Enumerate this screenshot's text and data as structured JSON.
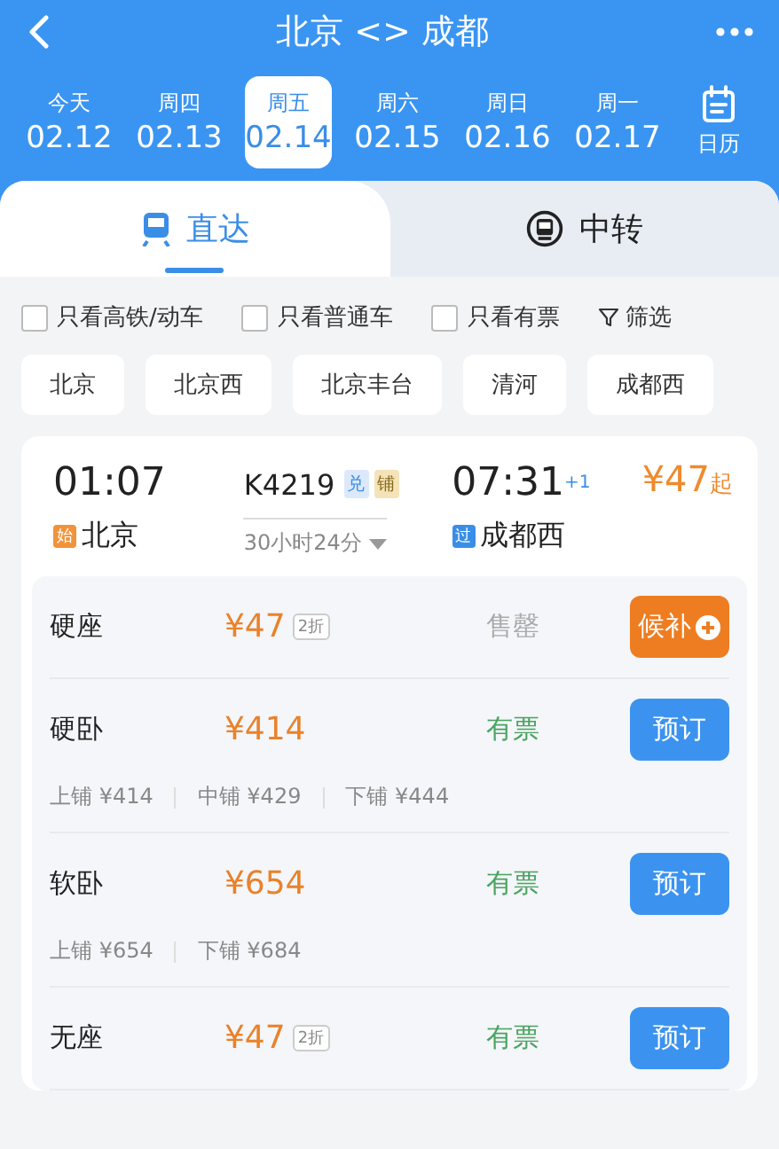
{
  "header": {
    "title": "北京 <> 成都"
  },
  "dates": [
    {
      "weekday": "今天",
      "date": "02.12",
      "selected": false
    },
    {
      "weekday": "周四",
      "date": "02.13",
      "selected": false
    },
    {
      "weekday": "周五",
      "date": "02.14",
      "selected": true
    },
    {
      "weekday": "周六",
      "date": "02.15",
      "selected": false
    },
    {
      "weekday": "周日",
      "date": "02.16",
      "selected": false
    },
    {
      "weekday": "周一",
      "date": "02.17",
      "selected": false
    }
  ],
  "calendar": {
    "label": "日历"
  },
  "tabs": [
    {
      "label": "直达",
      "kind": "direct",
      "selected": true
    },
    {
      "label": "中转",
      "kind": "transfer",
      "selected": false
    }
  ],
  "filters": [
    {
      "label": "只看高铁/动车",
      "checked": false
    },
    {
      "label": "只看普通车",
      "checked": false
    },
    {
      "label": "只看有票",
      "checked": false
    }
  ],
  "filter_button": {
    "label": "筛选"
  },
  "stations": [
    "北京",
    "北京西",
    "北京丰台",
    "清河",
    "成都西"
  ],
  "train": {
    "depart_time": "01:07",
    "depart_tag": "始",
    "depart_station": "北京",
    "number": "K4219",
    "badges": [
      {
        "text": "兑",
        "kind": "exchange"
      },
      {
        "text": "铺",
        "kind": "berth"
      }
    ],
    "duration": "30小时24分",
    "arrive_time": "07:31",
    "day_offset": "+1",
    "arrive_tag": "过",
    "arrive_station": "成都西",
    "price": "¥47",
    "price_suffix": "起"
  },
  "seats": [
    {
      "name": "硬座",
      "price": "¥47",
      "discount": "2折",
      "status": "售罄",
      "available": false,
      "action": {
        "label": "候补",
        "kind": "waitlist"
      }
    },
    {
      "name": "硬卧",
      "price": "¥414",
      "status": "有票",
      "available": true,
      "action": {
        "label": "预订",
        "kind": "book"
      },
      "berths": [
        "上铺 ¥414",
        "中铺 ¥429",
        "下铺 ¥444"
      ]
    },
    {
      "name": "软卧",
      "price": "¥654",
      "status": "有票",
      "available": true,
      "action": {
        "label": "预订",
        "kind": "book"
      },
      "berths": [
        "上铺 ¥654",
        "下铺 ¥684"
      ]
    },
    {
      "name": "无座",
      "price": "¥47",
      "discount": "2折",
      "status": "有票",
      "available": true,
      "action": {
        "label": "预订",
        "kind": "book"
      }
    }
  ]
}
